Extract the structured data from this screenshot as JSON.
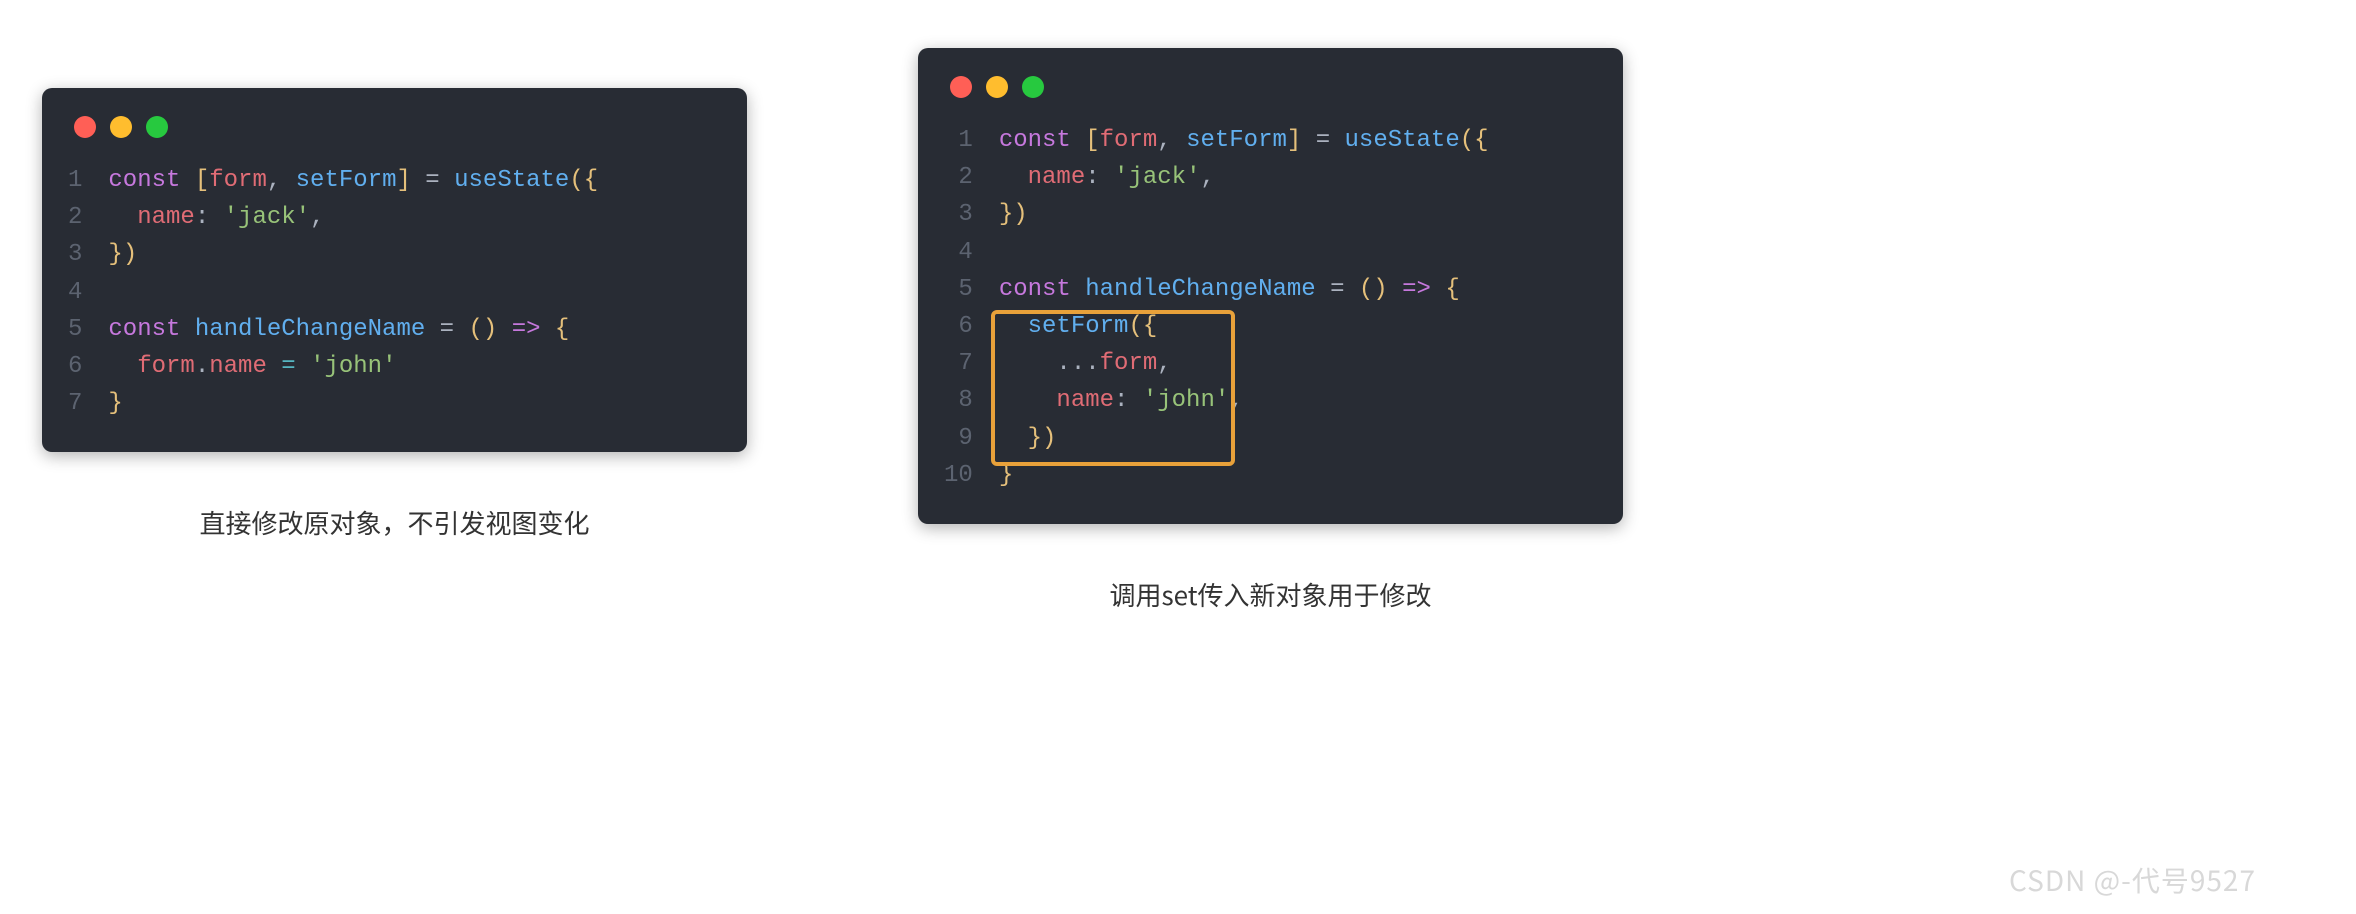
{
  "left": {
    "caption": "直接修改原对象，不引发视图变化",
    "lines": [
      "1",
      "2",
      "3",
      "4",
      "5",
      "6",
      "7"
    ],
    "code": {
      "l1": {
        "const": "const",
        "lb": "[",
        "form": "form",
        "c1": ",",
        "sp": " ",
        "setForm": "setForm",
        "rb": "]",
        "eq": " = ",
        "useState": "useState",
        "lp": "(",
        "lc": "{"
      },
      "l2": {
        "indent": "  ",
        "name": "name",
        "colon": ":",
        "sp": " ",
        "q1": "'",
        "val": "jack",
        "q2": "'",
        "comma": ","
      },
      "l3": {
        "rc": "}",
        "rp": ")"
      },
      "l5": {
        "const": "const",
        "fn": "handleChangeName",
        "eq": " = ",
        "lp": "(",
        "rp": ")",
        "arrow": " => ",
        "lc": "{"
      },
      "l6": {
        "indent": "  ",
        "obj": "form",
        "dot": ".",
        "prop": "name",
        "eq": " = ",
        "q1": "'",
        "val": "john",
        "q2": "'"
      },
      "l7": {
        "rc": "}"
      }
    }
  },
  "right": {
    "caption": "调用set传入新对象用于修改",
    "lines": [
      "1",
      "2",
      "3",
      "4",
      "5",
      "6",
      "7",
      "8",
      "9",
      "10"
    ],
    "code": {
      "l1": {
        "const": "const",
        "lb": "[",
        "form": "form",
        "c1": ",",
        "sp": " ",
        "setForm": "setForm",
        "rb": "]",
        "eq": " = ",
        "useState": "useState",
        "lp": "(",
        "lc": "{"
      },
      "l2": {
        "indent": "  ",
        "name": "name",
        "colon": ":",
        "sp": " ",
        "q1": "'",
        "val": "jack",
        "q2": "'",
        "comma": ","
      },
      "l3": {
        "rc": "}",
        "rp": ")"
      },
      "l5": {
        "const": "const",
        "fn": "handleChangeName",
        "eq": " = ",
        "lp": "(",
        "rp": ")",
        "arrow": " => ",
        "lc": "{"
      },
      "l6": {
        "indent": "  ",
        "setForm": "setForm",
        "lp": "(",
        "lc": "{"
      },
      "l7": {
        "indent": "    ",
        "spread": "...",
        "form": "form",
        "comma": ","
      },
      "l8": {
        "indent": "    ",
        "name": "name",
        "colon": ":",
        "sp": " ",
        "q1": "'",
        "val": "john",
        "q2": "'",
        "comma": ","
      },
      "l9": {
        "indent": "  ",
        "rc": "}",
        "rp": ")"
      },
      "l10": {
        "rc": "}"
      }
    }
  },
  "watermark": "CSDN @-代号9527"
}
